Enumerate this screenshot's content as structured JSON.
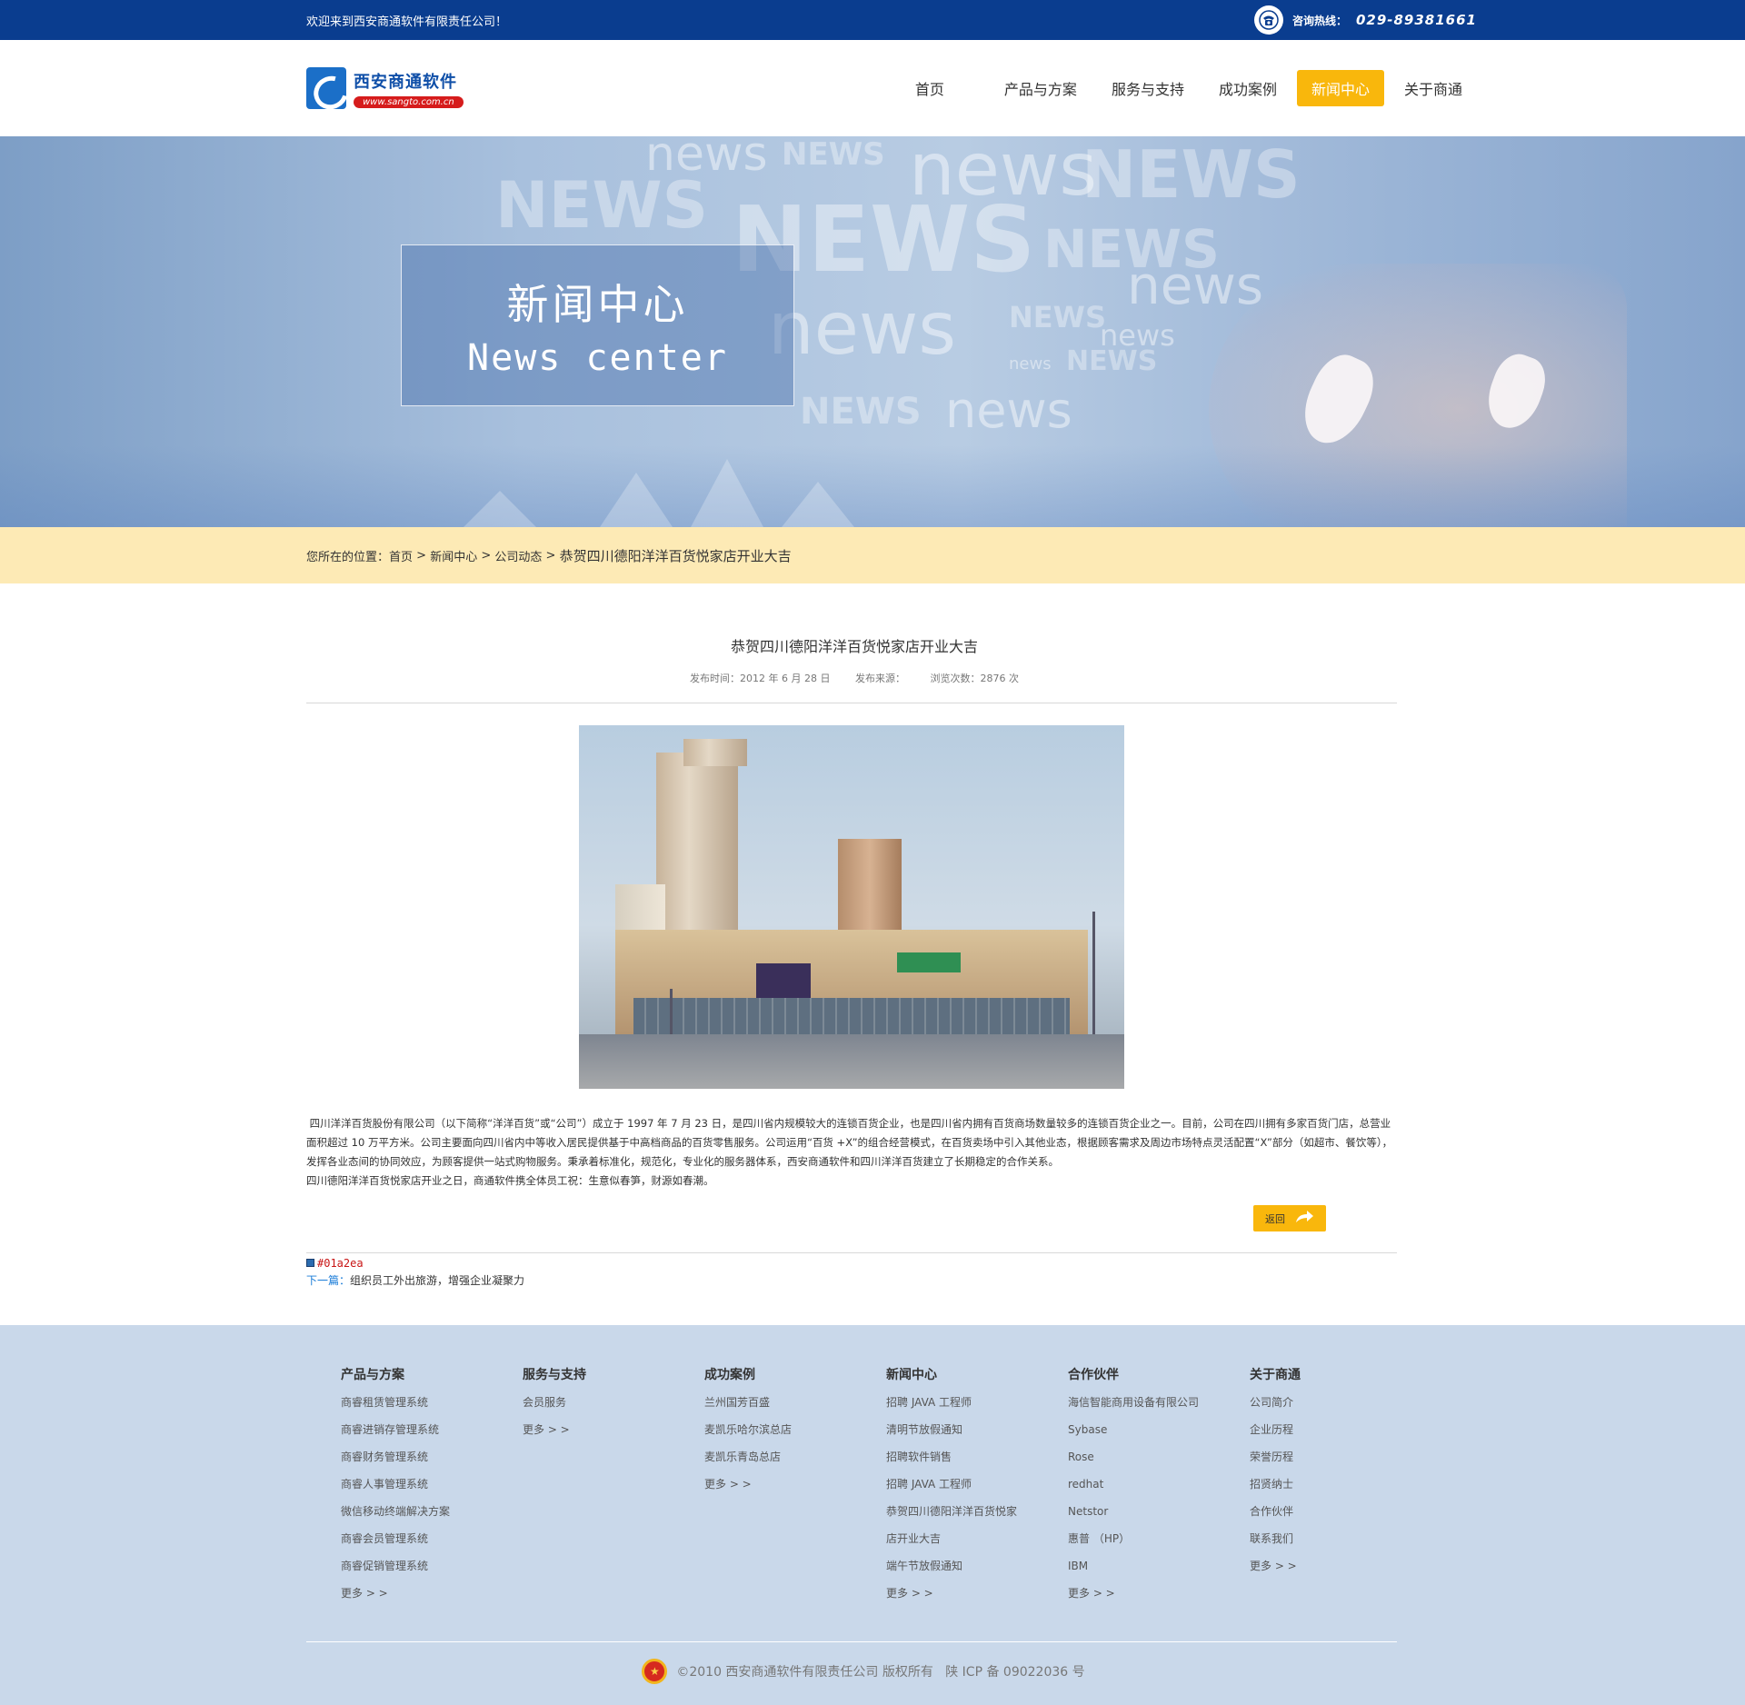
{
  "topbar": {
    "welcome": "欢迎来到西安商通软件有限责任公司！",
    "hotline_label": "咨询热线：",
    "hotline_number": "029-89381661"
  },
  "header": {
    "logo_cn": "西安商通软件",
    "logo_url": "www.sangto.com.cn",
    "nav": [
      {
        "label": "首页"
      },
      {
        "label": "产品与方案"
      },
      {
        "label": "服务与支持"
      },
      {
        "label": "成功案例"
      },
      {
        "label": "新闻中心",
        "active": true
      },
      {
        "label": "关于商通"
      }
    ]
  },
  "banner": {
    "title_cn": "新闻中心",
    "title_en": "News center"
  },
  "breadcrumb": {
    "prefix": "您所在的位置：",
    "home": "首页",
    "sep": " > ",
    "level1": "新闻中心",
    "level2": "公司动态",
    "current": "恭贺四川德阳洋洋百货悦家店开业大吉"
  },
  "article": {
    "title": "恭贺四川德阳洋洋百货悦家店开业大吉",
    "meta_date": "发布时间：2012 年 6 月 28 日",
    "meta_source": "发布来源：",
    "meta_views": "浏览次数：2876 次",
    "paragraph1": " 四川洋洋百货股份有限公司（以下简称“洋洋百货”或“公司”）成立于 1997 年 7 月 23 日，是四川省内规模较大的连锁百货企业，也是四川省内拥有百货商场数量较多的连锁百货企业之一。目前，公司在四川拥有多家百货门店，总营业面积超过 10 万平方米。公司主要面向四川省内中等收入居民提供基于中高档商品的百货零售服务。公司运用“百货 +X”的组合经营模式，在百货卖场中引入其他业态，根据顾客需求及周边市场特点灵活配置“X”部分（如超市、餐饮等），发挥各业态间的协同效应，为顾客提供一站式购物服务。秉承着标准化，规范化，专业化的服务器体系，西安商通软件和四川洋洋百货建立了长期稳定的合作关系。",
    "paragraph2": "四川德阳洋洋百货悦家店开业之日，商通软件携全体员工祝：生意似春笋，财源如春潮。",
    "back_label": "返回",
    "prev_text": "#01a2ea",
    "next_label": "下一篇：",
    "next_title": "组织员工外出旅游，增强企业凝聚力"
  },
  "footer": {
    "columns": [
      {
        "title": "产品与方案",
        "items": [
          "商睿租赁管理系统",
          "商睿进销存管理系统",
          "商睿财务管理系统",
          "商睿人事管理系统",
          "微信移动终端解决方案",
          "商睿会员管理系统",
          "商睿促销管理系统",
          "更多 > >"
        ]
      },
      {
        "title": "服务与支持",
        "items": [
          "会员服务",
          "更多 > >"
        ]
      },
      {
        "title": "成功案例",
        "items": [
          "兰州国芳百盛",
          "麦凯乐哈尔滨总店",
          "麦凯乐青岛总店",
          "更多 > >"
        ]
      },
      {
        "title": "新闻中心",
        "items": [
          "招聘 JAVA 工程师",
          "清明节放假通知",
          "招聘软件销售",
          "招聘 JAVA 工程师",
          "恭贺四川德阳洋洋百货悦家",
          "店开业大吉",
          "端午节放假通知",
          "更多 > >"
        ]
      },
      {
        "title": "合作伙伴",
        "items": [
          "海信智能商用设备有限公司",
          "Sybase",
          "Rose",
          "redhat",
          "Netstor",
          "惠普 （HP）",
          "IBM",
          "更多 > >"
        ]
      },
      {
        "title": "关于商通",
        "items": [
          "公司简介",
          "企业历程",
          "荣誉历程",
          "招贤纳士",
          "合作伙伴",
          "联系我们",
          "更多 > >"
        ]
      }
    ],
    "copyright": "©2010 西安商通软件有限责任公司 版权所有   陕 ICP 备 09022036 号"
  }
}
